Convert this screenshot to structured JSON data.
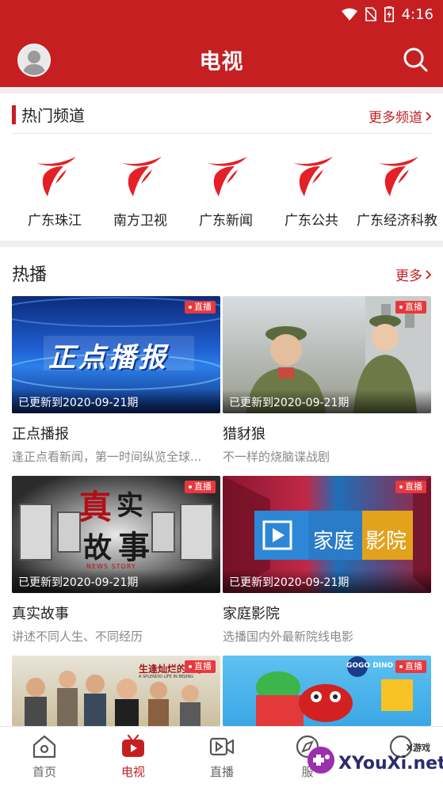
{
  "status": {
    "time": "4:16"
  },
  "header": {
    "title": "电视"
  },
  "channels_section": {
    "title": "热门频道",
    "more_label": "更多频道",
    "items": [
      {
        "name": "广东珠江"
      },
      {
        "name": "南方卫视"
      },
      {
        "name": "广东新闻"
      },
      {
        "name": "广东公共"
      },
      {
        "name": "广东经济科教"
      }
    ]
  },
  "hot_section": {
    "title": "热播",
    "more_label": "更多",
    "live_label": "直播",
    "cards": [
      {
        "title": "正点播报",
        "desc": "逢正点看新闻，第一时间纵览全球...",
        "updated": "已更新到2020-09-21期"
      },
      {
        "title": "猎豺狼",
        "desc": "不一样的烧脑谍战剧",
        "updated": "已更新到2020-09-21期"
      },
      {
        "title": "真实故事",
        "desc": "讲述不同人生、不同经历",
        "updated": "已更新到2020-09-21期"
      },
      {
        "title": "家庭影院",
        "desc": "选播国内外最新院线电影",
        "updated": "已更新到2020-09-21期"
      },
      {
        "title": "",
        "desc": "",
        "updated": ""
      },
      {
        "title": "",
        "desc": "",
        "updated": ""
      }
    ],
    "thumb_text": {
      "zhengdian": "正点播报",
      "zhenshi_a": "真",
      "zhenshi_b": "实",
      "zhenshi_c": "故",
      "zhenshi_d": "事",
      "news_story": "NEWS STORY",
      "jiating_a": "家庭",
      "jiating_b": "影院",
      "drama": "生逢灿烂的日子",
      "drama_en": "A SPLENDID LIFE IN BEIJING",
      "gogo": "GOGO DINO"
    }
  },
  "bottom_nav": {
    "items": [
      {
        "label": "首页"
      },
      {
        "label": "电视"
      },
      {
        "label": "直播"
      },
      {
        "label": "服"
      }
    ]
  },
  "watermark": {
    "text": "XYouXi.net",
    "small": "X游戏"
  },
  "colors": {
    "brand": "#c61f22",
    "badge": "#e8383d"
  }
}
